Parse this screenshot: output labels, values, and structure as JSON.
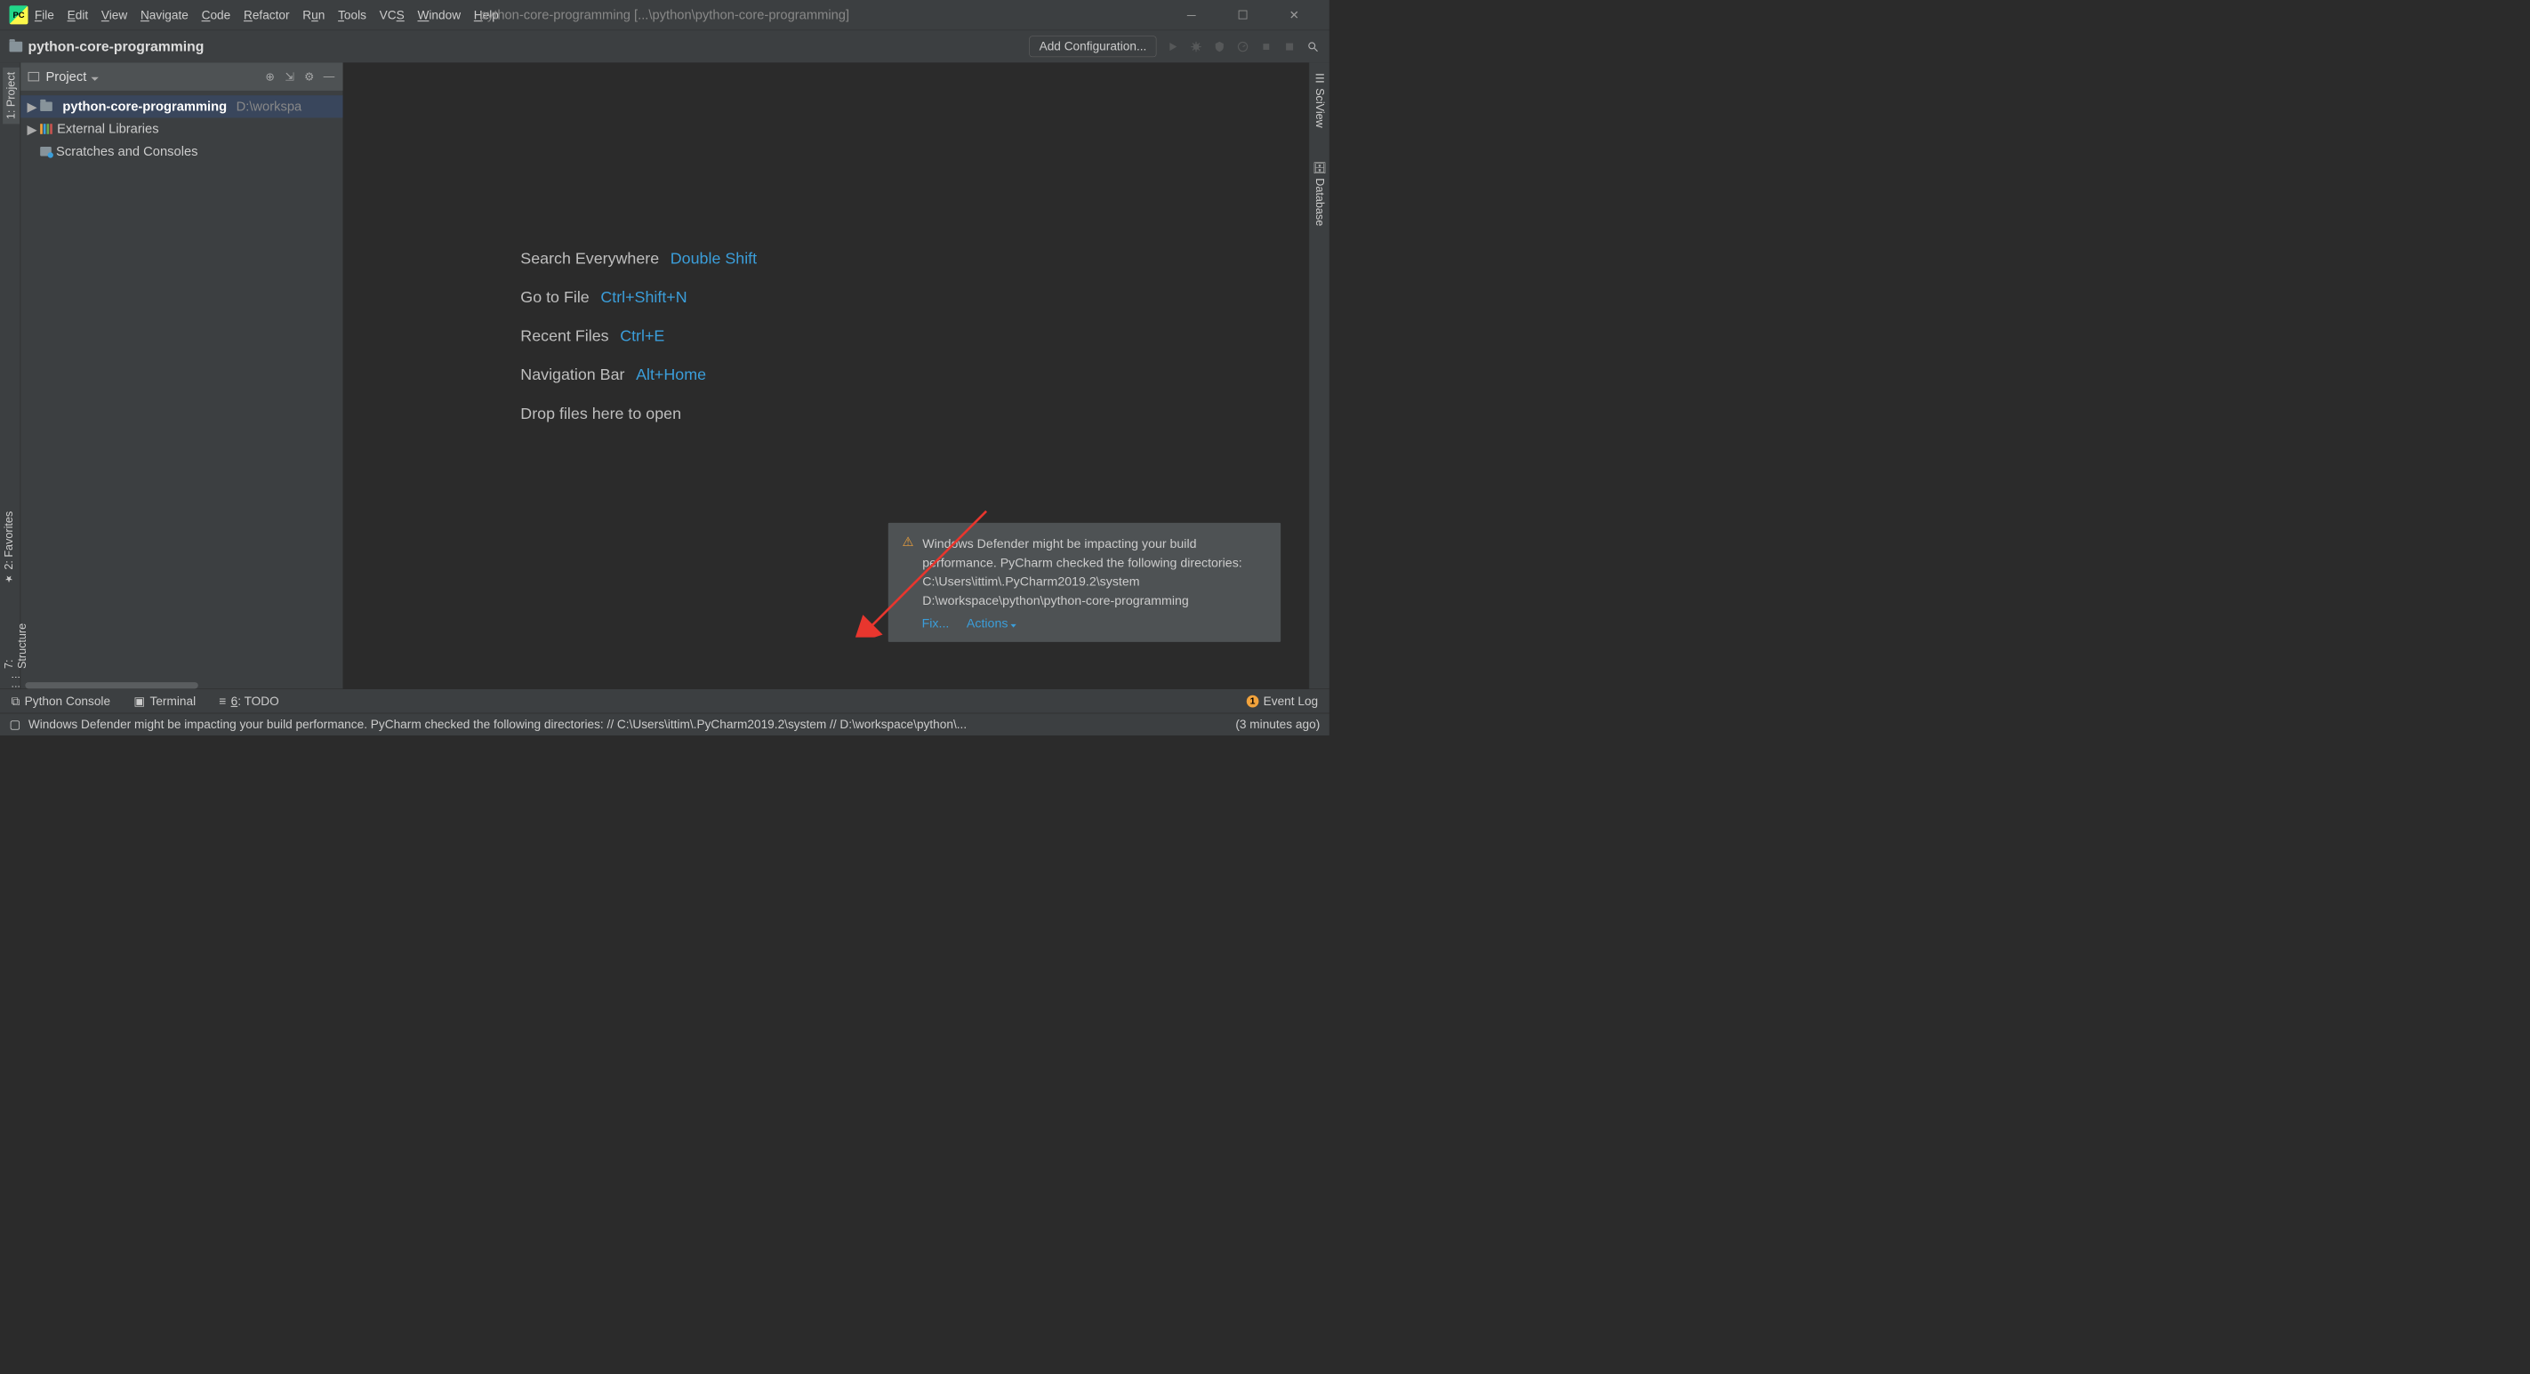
{
  "title": "python-core-programming [...\\python\\python-core-programming]",
  "menubar": [
    "File",
    "Edit",
    "View",
    "Navigate",
    "Code",
    "Refactor",
    "Run",
    "Tools",
    "VCS",
    "Window",
    "Help"
  ],
  "menubar_mnemonics": [
    "F",
    "E",
    "V",
    "N",
    "C",
    "R",
    "u",
    "T",
    "S",
    "W",
    "H"
  ],
  "navbar": {
    "project": "python-core-programming",
    "add_config": "Add Configuration..."
  },
  "sidebar": {
    "header": "Project",
    "tree": [
      {
        "name": "python-core-programming",
        "path": "D:\\workspa",
        "icon": "folder"
      },
      {
        "name": "External Libraries",
        "icon": "extlib"
      },
      {
        "name": "Scratches and Consoles",
        "icon": "scratch"
      }
    ]
  },
  "left_tabs": {
    "project": "1: Project",
    "favorites": "2: Favorites",
    "structure": "7: Structure"
  },
  "right_tabs": {
    "sciview": "SciView",
    "database": "Database"
  },
  "editor_tips": [
    {
      "label": "Search Everywhere",
      "key": "Double Shift"
    },
    {
      "label": "Go to File",
      "key": "Ctrl+Shift+N"
    },
    {
      "label": "Recent Files",
      "key": "Ctrl+E"
    },
    {
      "label": "Navigation Bar",
      "key": "Alt+Home"
    }
  ],
  "editor_drop": "Drop files here to open",
  "notification": {
    "text": "Windows Defender might be impacting your build performance. PyCharm checked the following directories:\nC:\\Users\\ittim\\.PyCharm2019.2\\system\nD:\\workspace\\python\\python-core-programming",
    "fix": "Fix...",
    "actions": "Actions"
  },
  "bottom_tabs": {
    "python_console": "Python Console",
    "terminal": "Terminal",
    "todo": "6: TODO",
    "event_log": "Event Log",
    "event_count": "1"
  },
  "statusbar": {
    "msg": "Windows Defender might be impacting your build performance. PyCharm checked the following directories: // C:\\Users\\ittim\\.PyCharm2019.2\\system // D:\\workspace\\python\\...",
    "time": "(3 minutes ago)"
  }
}
